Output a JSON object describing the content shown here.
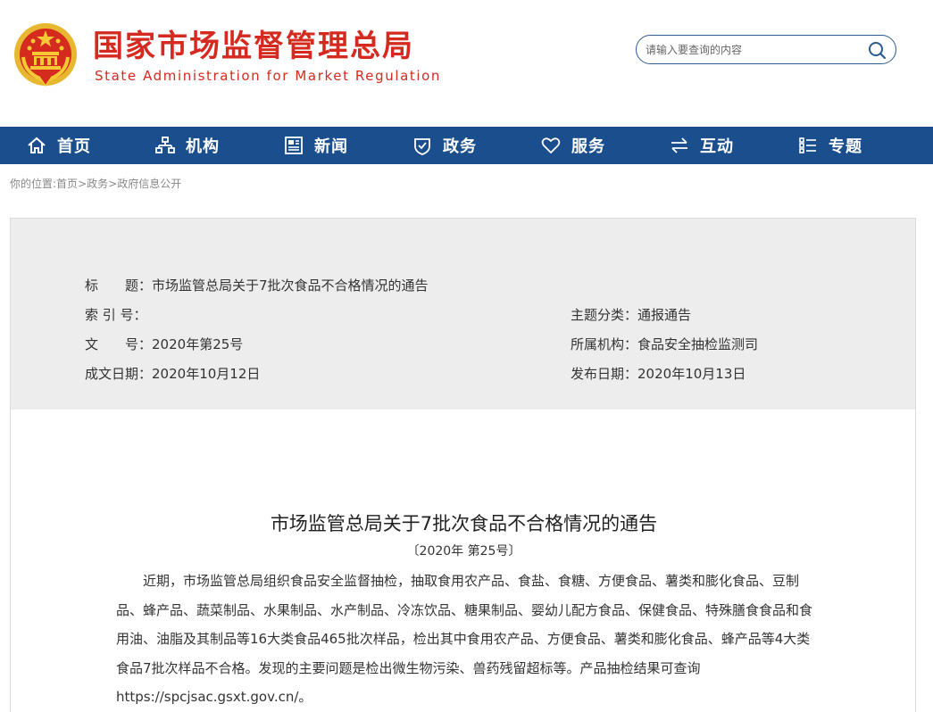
{
  "header": {
    "title_cn": "国家市场监督管理总局",
    "title_en": "State Administration for Market Regulation",
    "search_placeholder": "请输入要查询的内容",
    "brand_color": "#d52a1f"
  },
  "nav": {
    "color": "#1b4e8c",
    "items": [
      {
        "label": "首页",
        "icon": "home-icon"
      },
      {
        "label": "机构",
        "icon": "org-chart-icon"
      },
      {
        "label": "新闻",
        "icon": "news-icon"
      },
      {
        "label": "政务",
        "icon": "shield-check-icon"
      },
      {
        "label": "服务",
        "icon": "heart-icon"
      },
      {
        "label": "互动",
        "icon": "exchange-arrows-icon"
      },
      {
        "label": "专题",
        "icon": "topic-list-icon"
      }
    ]
  },
  "breadcrumb": {
    "prefix": "你的位置:",
    "items": [
      "首页",
      "政务",
      "政府信息公开"
    ],
    "separator": ">"
  },
  "info": {
    "title_label": "标　　题：",
    "title_value": "市场监管总局关于7批次食品不合格情况的通告",
    "index_label": "索 引 号：",
    "index_value": "",
    "topic_label": "主题分类：",
    "topic_value": "通报通告",
    "docno_label": "文　　号：",
    "docno_value": "2020年第25号",
    "org_label": "所属机构：",
    "org_value": "食品安全抽检监测司",
    "written_label": "成文日期：",
    "written_value": "2020年10月12日",
    "published_label": "发布日期：",
    "published_value": "2020年10月13日"
  },
  "article": {
    "title": "市场监管总局关于7批次食品不合格情况的通告",
    "doc_number": "〔2020年 第25号〕",
    "paragraph": "近期，市场监管总局组织食品安全监督抽检，抽取食用农产品、食盐、食糖、方便食品、薯类和膨化食品、豆制品、蜂产品、蔬菜制品、水果制品、水产制品、冷冻饮品、糖果制品、婴幼儿配方食品、保健食品、特殊膳食食品和食用油、油脂及其制品等16大类食品465批次样品，检出其中食用农产品、方便食品、薯类和膨化食品、蜂产品等4大类食品7批次样品不合格。发现的主要问题是检出微生物污染、兽药残留超标等。产品抽检结果可查询https://spcjsac.gsxt.gov.cn/。"
  }
}
